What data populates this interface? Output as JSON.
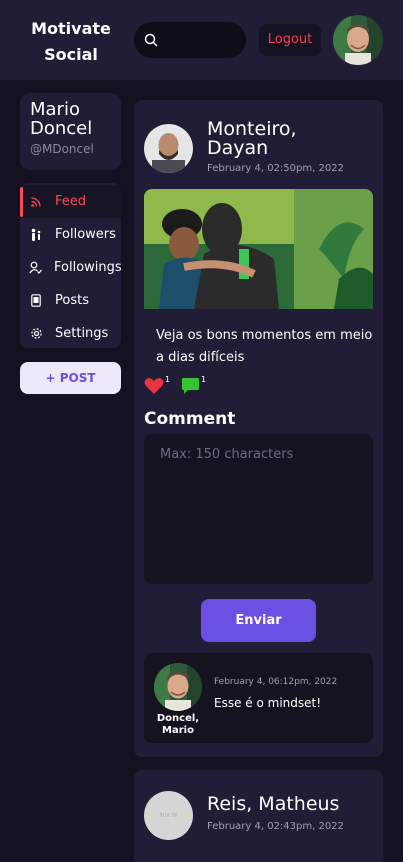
{
  "header": {
    "logo_line1": "Motivate",
    "logo_line2": "Social",
    "search_placeholder": "",
    "logout_label": "Logout"
  },
  "sidebar": {
    "user": {
      "name": "Mario Doncel",
      "handle": "@MDoncel"
    },
    "nav": [
      {
        "label": "Feed",
        "icon": "rss-icon",
        "active": true
      },
      {
        "label": "Followers",
        "icon": "followers-icon",
        "active": false
      },
      {
        "label": "Followings",
        "icon": "user-check-icon",
        "active": false
      },
      {
        "label": "Posts",
        "icon": "posts-icon",
        "active": false
      },
      {
        "label": "Settings",
        "icon": "gear-icon",
        "active": false
      }
    ],
    "post_button": "+ POST"
  },
  "posts": [
    {
      "author": "Monteiro, Dayan",
      "date": "February 4, 02:50pm, 2022",
      "text": "Veja os bons momentos em meio a dias difíceis",
      "likes": "1",
      "comments": "1",
      "comment_title": "Comment",
      "comment_placeholder": "Max: 150 characters",
      "send_label": "Enviar",
      "replies": [
        {
          "author": "Doncel, Mario",
          "date": "February 4, 06:12pm, 2022",
          "text": "Esse é o mindset!"
        }
      ]
    },
    {
      "author": "Reis, Matheus",
      "date": "February 4, 02:43pm, 2022",
      "avatar_placeholder": "Mix W"
    }
  ],
  "colors": {
    "background": "#141220",
    "card": "#221d36",
    "accent": "#6b4fe3",
    "danger": "#ff4757",
    "like": "#e8353f",
    "comment": "#35c42f"
  }
}
